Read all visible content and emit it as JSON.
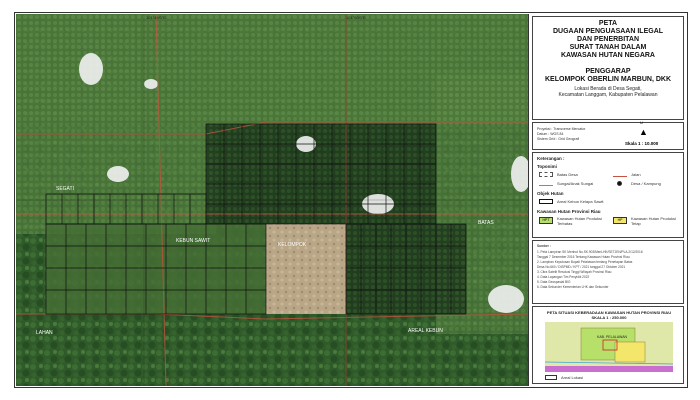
{
  "title": {
    "line1": "PETA",
    "line2": "DUGAAN PENGUASAAN ILEGAL",
    "line3": "DAN PENERBITAN",
    "line4": "SURAT TANAH DALAM",
    "line5": "KAWASAN HUTAN NEGARA",
    "line6": "PENGGARAP",
    "line7": "KELOMPOK OBERLIN MARBUN, DKK",
    "loc1": "Lokasi Berada di Desa Segati,",
    "loc2": "Kecamatan Langgam, Kabupaten Pelalawan"
  },
  "info": {
    "north": "▲",
    "north_label": "U",
    "scale": "Skala 1 : 10.000",
    "proyeksi": "Proyeksi : Transverse Mercator",
    "datum": "Datum : WGS 84",
    "sistem": "Sistem Grid : Grid Geografi"
  },
  "keterangan": {
    "heading": "Keterangan :",
    "toponimi": "Toponimi",
    "batas_desa": "Batas Desa",
    "jalan": "Jalan",
    "sungai": "Sungai/Anak Sungai",
    "desa": "Desa / Kampung",
    "objek": "Objek Hutan",
    "areal": "Areal Kebun Kelapa Sawit",
    "kawasan": "Kawasan Hutan Provinsi Riau",
    "hpt_code": "HPT",
    "hpt": "Kawasan Hutan Produksi Terbatas",
    "hp_code": "HP",
    "hp": "Kawasan Hutan Produksi Tetap"
  },
  "notes": {
    "heading": "Sumber :",
    "items": [
      "1. Peta Lampiran SK Menhut No.SK.903/MenLHK/SETJEN/PLA.2/12/2016",
      "   Tanggal 7 Desember 2016 Tentang Kawasan Hutan Provinsi Riau",
      "2. Lampiran Keputusan Bupati Pelalawan tentang Penetapan Batas",
      "   Desa No.660 / DISPMD / KPT / 2021 tanggal 27 Oktober 2021",
      "3. Citra Satelit Resolusi Tinggi Wilayah Provinsi Riau",
      "4. Data Lapangan Tim Penyidik 2022",
      "5. Data Geospasial BIG",
      "6. Data Sekunder Kementerian LHK dan Sekunder"
    ]
  },
  "inset": {
    "title1": "PETA SITUASI KEBERADAAN KAWASAN HUTAN PROVINSI RIAU",
    "title2": "SKALA 1 : 250.000",
    "legend": "Areal Lokasi",
    "place": "KAB. PELALAWAN"
  },
  "map": {
    "ticks_top": [
      "101°49'0\"E",
      "101°50'0\"E"
    ],
    "labels": [
      "SEGATI",
      "KEBUN SAWIT",
      "KELOMPOK",
      "LAHAN",
      "AREAL KEBUN",
      "BATAS"
    ]
  }
}
